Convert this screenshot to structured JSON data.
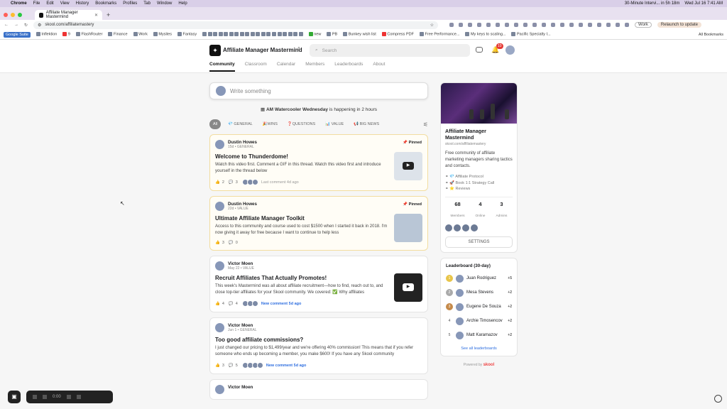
{
  "mac": {
    "app": "Chrome",
    "menus": [
      "File",
      "Edit",
      "View",
      "History",
      "Bookmarks",
      "Profiles",
      "Tab",
      "Window",
      "Help"
    ],
    "meeting": "30-Minute Intervi... in 5h 18m",
    "datetime": "Wed Jul 16  7:41 AM"
  },
  "browser": {
    "tab_title": "Affiliate Manager Mastermind",
    "url": "skool.com/affiliatemastery",
    "profile": "Work",
    "relaunch": "Relaunch to update"
  },
  "bookmarks": [
    "Google Suite",
    "Inflektion",
    "9",
    "FlashRouter",
    "Finance",
    "Work",
    "Mysites",
    "Fantasy",
    "new",
    "PB",
    "Bunkey wish list",
    "Compress PDF",
    "Free Performance...",
    "My keys to scaling...",
    "Pacific Specialty I...",
    "All Bookmarks"
  ],
  "header": {
    "group_name": "Affiliate Manager Mastermind",
    "search_placeholder": "Search",
    "notif_count": "10",
    "nav": [
      "Community",
      "Classroom",
      "Calendar",
      "Members",
      "Leaderboards",
      "About"
    ]
  },
  "feed": {
    "write_placeholder": "Write something",
    "event_title": "AM Watercooler Wednesday",
    "event_suffix": "is happening in 2 hours",
    "categories": [
      "All",
      "GENERAL",
      "WINS",
      "QUESTIONS",
      "VALUE",
      "BIG NEWS"
    ],
    "posts": [
      {
        "author": "Dustin Howes",
        "meta": "15d • GENERAL",
        "pinned": "Pinned",
        "title": "Welcome to Thunderdome!",
        "body": "Watch this video first. Comment a GIF in this thread. Watch this video first and introduce yourself in the thread below",
        "likes": "2",
        "comments": "3",
        "activity": "Last comment 4d ago"
      },
      {
        "author": "Dustin Howes",
        "meta": "22d • VALUE",
        "pinned": "Pinned",
        "title": "Ultimate Affiliate Manager Toolkit",
        "body": "Access to this community and course used to cost $1500 when I started it back in 2018. I'm now giving it away for free because I want to continue to help less",
        "likes": "3",
        "comments": "0",
        "activity": ""
      },
      {
        "author": "Victor Moen",
        "meta": "May 22 • VALUE",
        "pinned": "",
        "title": "Recruit Affiliates That Actually Promotes!",
        "body": "This week's Mastermind was all about affiliate recruitment—how to find, reach out to, and close top-tier affiliates for your Skool community. We covered: ✅ Why affiliates",
        "likes": "4",
        "comments": "4",
        "activity": "New comment 5d ago"
      },
      {
        "author": "Victor Moen",
        "meta": "Jun 1 • GENERAL",
        "pinned": "",
        "title": "Too good affiliate commissions?",
        "body": "I just changed our pricing to $1,499/year and we're offering 40% commission! This means that if you refer someone who ends up becoming a member, you make $600! If you have any Skool community",
        "likes": "3",
        "comments": "5",
        "activity": "New comment 5d ago"
      },
      {
        "author": "Victor Moen"
      }
    ]
  },
  "sidebar": {
    "title": "Affiliate Manager Mastermind",
    "url": "skool.com/affiliatemastery",
    "desc": "Free community of affiliate marketing managers sharing tactics and contacts.",
    "links": [
      "Affiliate Protocol",
      "Book 1:1 Strategy Call",
      "Reviews"
    ],
    "stats": [
      {
        "n": "68",
        "l": "Members"
      },
      {
        "n": "4",
        "l": "Online"
      },
      {
        "n": "3",
        "l": "Admins"
      }
    ],
    "settings": "SETTINGS",
    "leaderboard_title": "Leaderboard (30-day)",
    "leaders": [
      {
        "rank": "1",
        "name": "Juan Rodriguez",
        "pts": "+5"
      },
      {
        "rank": "2",
        "name": "Mesa Stevens",
        "pts": "+2"
      },
      {
        "rank": "3",
        "name": "Eugene De Souza",
        "pts": "+2"
      },
      {
        "rank": "4",
        "name": "Archie Timosencov",
        "pts": "+2"
      },
      {
        "rank": "5",
        "name": "Matt Karamazov",
        "pts": "+2"
      }
    ],
    "see_all": "See all leaderboards",
    "powered": "Powered by",
    "brand": "skool"
  },
  "recorder": {
    "time": "0:00"
  },
  "colors": {
    "accent": "#2f6fe0",
    "pinned_border": "#f2dda0",
    "notif": "#e53935"
  }
}
